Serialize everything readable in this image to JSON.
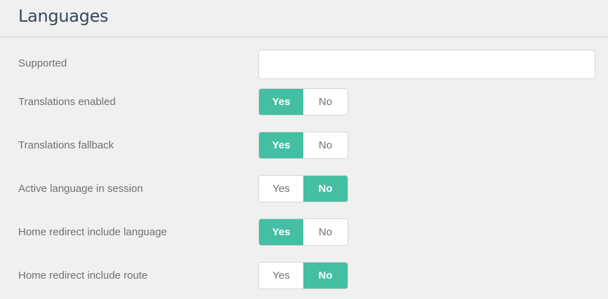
{
  "header": {
    "title": "Languages"
  },
  "supported": {
    "label": "Supported",
    "value": "",
    "placeholder": ""
  },
  "settings": [
    {
      "label": "Translations enabled",
      "yes": "Yes",
      "no": "No",
      "selected": "yes"
    },
    {
      "label": "Translations fallback",
      "yes": "Yes",
      "no": "No",
      "selected": "yes"
    },
    {
      "label": "Active language in session",
      "yes": "Yes",
      "no": "No",
      "selected": "no"
    },
    {
      "label": "Home redirect include language",
      "yes": "Yes",
      "no": "No",
      "selected": "yes"
    },
    {
      "label": "Home redirect include route",
      "yes": "Yes",
      "no": "No",
      "selected": "no"
    }
  ],
  "colors": {
    "accent": "#44bfa3",
    "title": "#34495e",
    "label": "#707070"
  }
}
